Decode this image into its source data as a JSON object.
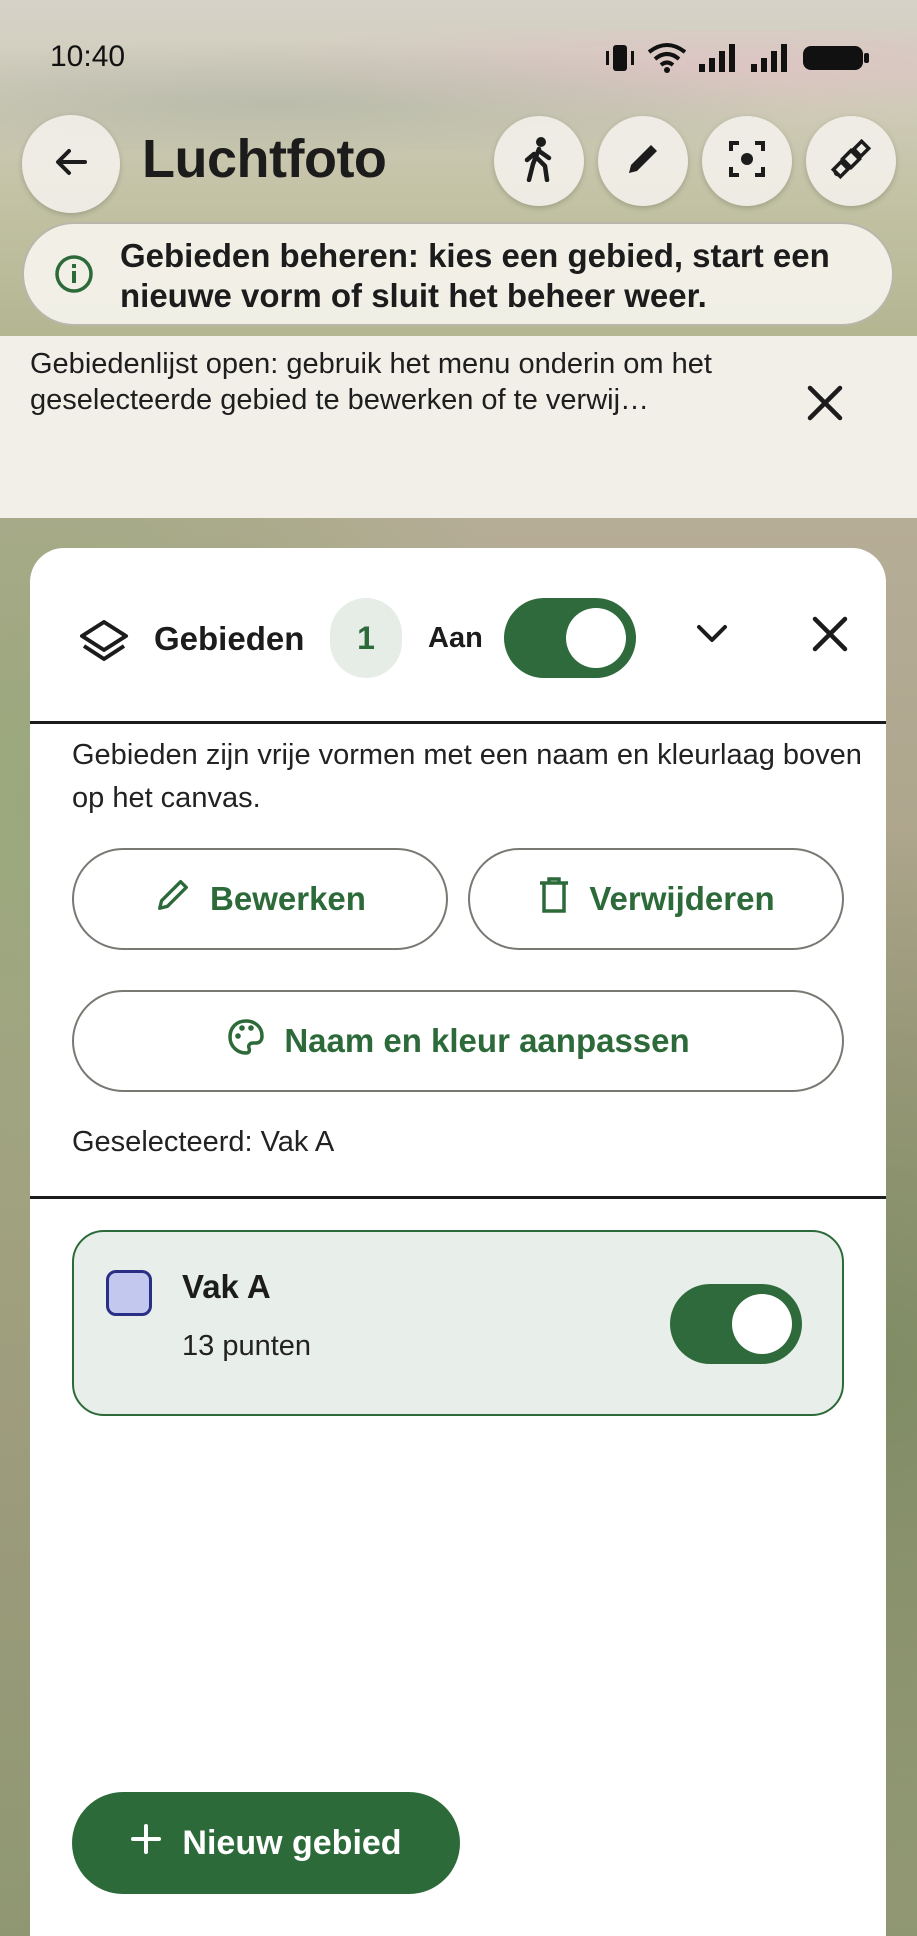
{
  "status_bar": {
    "time": "10:40"
  },
  "app_bar": {
    "title": "Luchtfoto",
    "icons": [
      "back-arrow-icon",
      "walk-icon",
      "pencil-icon",
      "focus-center-icon",
      "satellite-icon"
    ]
  },
  "info_banner": {
    "text": "Gebieden beheren: kies een gebied, start een nieuwe vorm of sluit het beheer weer."
  },
  "message": {
    "text": "Gebiedenlijst open: gebruik het menu onderin om het geselecteerde gebied te bewerken of te verwij…"
  },
  "panel": {
    "title": "Gebieden",
    "count": "1",
    "toggle_label": "Aan",
    "toggle_on": true,
    "description": "Gebieden zijn vrije vormen met een naam en kleurlaag boven op het canvas.",
    "edit_label": "Bewerken",
    "delete_label": "Verwijderen",
    "rename_label": "Naam en kleur aanpassen",
    "selected_text": "Geselecteerd: Vak A"
  },
  "areas": [
    {
      "name": "Vak A",
      "points": "13 punten",
      "color": "#c3c8ef",
      "border_color": "#2a2f86",
      "visible": true
    }
  ],
  "fab": {
    "label": "Nieuw gebied"
  },
  "colors": {
    "accent": "#2d6a3a",
    "card_bg": "#e8eee9"
  }
}
